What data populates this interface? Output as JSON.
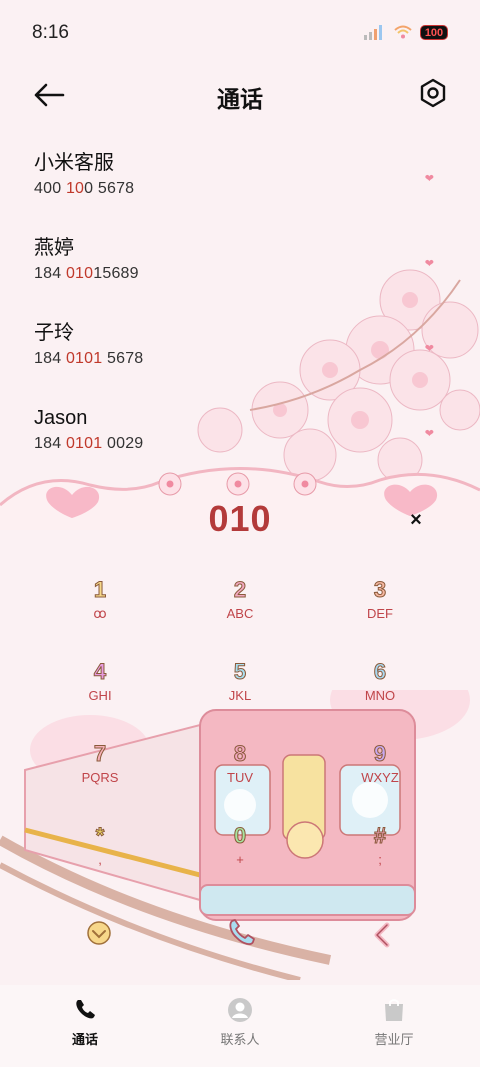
{
  "status": {
    "time": "8:16",
    "battery": "100"
  },
  "header": {
    "title": "通话"
  },
  "contacts": [
    {
      "name": "小米客服",
      "num_a": "400",
      "num_hl1": " 10",
      "num_b": "0 5678",
      "num_hl2": ""
    },
    {
      "name": "燕婷",
      "num_a": "184 ",
      "num_hl1": "010",
      "num_b": "15689",
      "num_hl2": ""
    },
    {
      "name": "子玲",
      "num_a": "184 ",
      "num_hl1": "0101",
      "num_b": " 5678",
      "num_hl2": ""
    },
    {
      "name": "Jason",
      "num_a": "184 ",
      "num_hl1": "0101",
      "num_b": " 0029",
      "num_hl2": ""
    }
  ],
  "dial": {
    "number": "010",
    "clear_label": "×"
  },
  "keypad": [
    {
      "digit": "1",
      "letters": "ꝏ",
      "color": "#f6d98a"
    },
    {
      "digit": "2",
      "letters": "ABC",
      "color": "#f2a8c0"
    },
    {
      "digit": "3",
      "letters": "DEF",
      "color": "#f5b7a0"
    },
    {
      "digit": "4",
      "letters": "GHI",
      "color": "#e79be0"
    },
    {
      "digit": "5",
      "letters": "JKL",
      "color": "#a9dff0"
    },
    {
      "digit": "6",
      "letters": "MNO",
      "color": "#a9d9f2"
    },
    {
      "digit": "7",
      "letters": "PQRS",
      "color": "#f6b0b8"
    },
    {
      "digit": "8",
      "letters": "TUV",
      "color": "#f2a6bf"
    },
    {
      "digit": "9",
      "letters": "WXYZ",
      "color": "#c8a8ef"
    },
    {
      "digit": "*",
      "letters": ",",
      "color": "#f5e36a"
    },
    {
      "digit": "0",
      "letters": "+",
      "color": "#a8e4a0"
    },
    {
      "digit": "#",
      "letters": ";",
      "color": "#f5a8c6"
    }
  ],
  "nav": [
    {
      "label": "通话"
    },
    {
      "label": "联系人"
    },
    {
      "label": "营业厅"
    }
  ],
  "colors": {
    "accent": "#b33a3a",
    "highlight": "#c0392b",
    "background": "#fbf1f3"
  }
}
